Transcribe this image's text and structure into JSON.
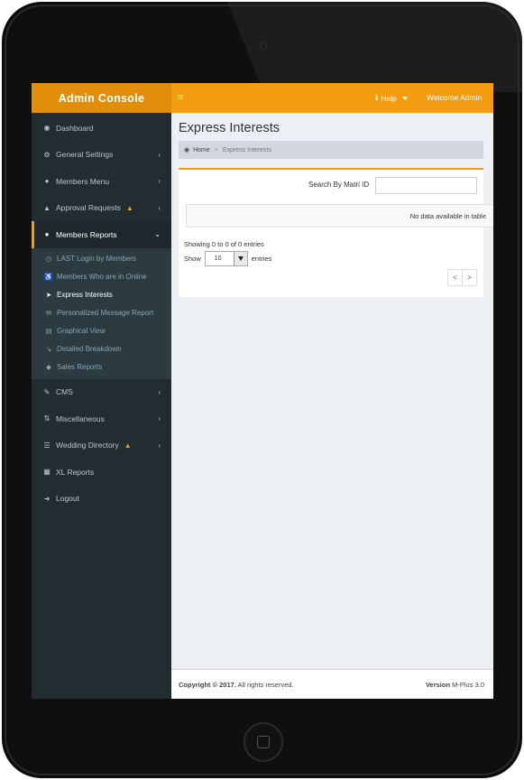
{
  "header": {
    "brand": "Admin Console",
    "toggle_icon": "≡",
    "help_label": "Help",
    "welcome": "Welcome Admin"
  },
  "sidebar": {
    "items_top": [
      {
        "label": "Dashboard",
        "icon": "dashboard-icon"
      },
      {
        "label": "General Settings",
        "icon": "cogs-icon"
      },
      {
        "label": "Members Menu",
        "icon": "user-icon"
      },
      {
        "label": "Approval Requests",
        "icon": "bell-icon"
      }
    ],
    "members_reports": {
      "label": "Members Reports",
      "icon": "users-icon",
      "submenu": [
        {
          "label": "LAST Login by Members",
          "icon": "clock-icon"
        },
        {
          "label": "Members Who are in Online",
          "icon": "wheelchair-icon"
        },
        {
          "label": "Express Interests",
          "icon": "paper-plane-icon"
        },
        {
          "label": "Personalized Message Report",
          "icon": "envelope-icon"
        },
        {
          "label": "Graphical View",
          "icon": "bar-chart-icon"
        },
        {
          "label": "Detailed Breakdown",
          "icon": "line-chart-icon"
        },
        {
          "label": "Sales Reports",
          "icon": "tags-icon"
        }
      ]
    },
    "items_bottom": [
      {
        "label": "CMS",
        "icon": "edit-icon"
      },
      {
        "label": "Miscellaneous",
        "icon": "signpost-icon"
      },
      {
        "label": "Wedding Directory",
        "icon": "database-icon"
      },
      {
        "label": "XL Reports",
        "icon": "file-excel-icon"
      },
      {
        "label": "Logout",
        "icon": "sign-out-icon"
      }
    ]
  },
  "main": {
    "title": "Express Interests",
    "breadcrumb": {
      "home": "Home",
      "current": "Express Interests"
    },
    "search_label": "Search By Matri ID",
    "search_value": "",
    "no_data": "No data available in table",
    "info": "Showing 0 to 0 of 0 entries",
    "show_label": "Show",
    "page_size": "10",
    "entries_label": "entries",
    "pager_prev": "<",
    "pager_next": ">"
  },
  "footer": {
    "copyright_bold": "Copyright © 2017.",
    "copyright_rest": " All rights reserved.",
    "version_label": "Version",
    "version_value": " M-Plus 3.0"
  },
  "colors": {
    "accent": "#f39c12",
    "sidebar": "#222d32",
    "content_bg": "#ecf0f5"
  }
}
